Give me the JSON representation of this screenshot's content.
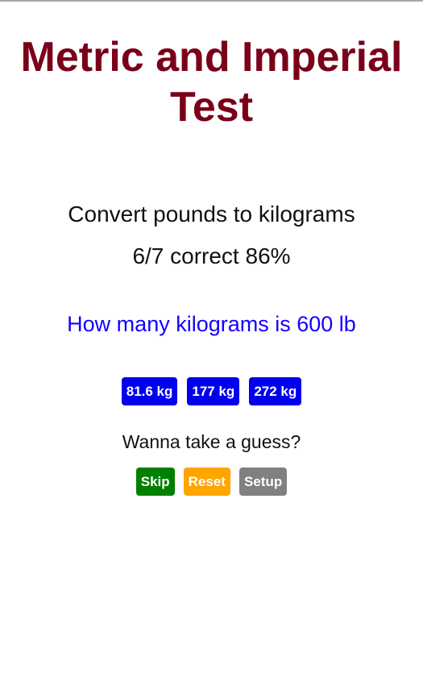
{
  "app": {
    "title_line1": "Metric and Imperial",
    "title_line2": "Test"
  },
  "quiz": {
    "subtitle": "Convert pounds to kilograms",
    "score": "6/7 correct 86%",
    "question": "How many kilograms is 600 lb",
    "answers": [
      "81.6 kg",
      "177 kg",
      "272 kg"
    ],
    "hint": "Wanna take a guess?"
  },
  "actions": {
    "skip_label": "Skip",
    "reset_label": "Reset",
    "setup_label": "Setup"
  },
  "colors": {
    "title": "#7a0019",
    "question": "#1400ff",
    "answer_button": "#0000ee",
    "skip": "#008000",
    "reset": "#ffa500",
    "setup": "#808080"
  }
}
